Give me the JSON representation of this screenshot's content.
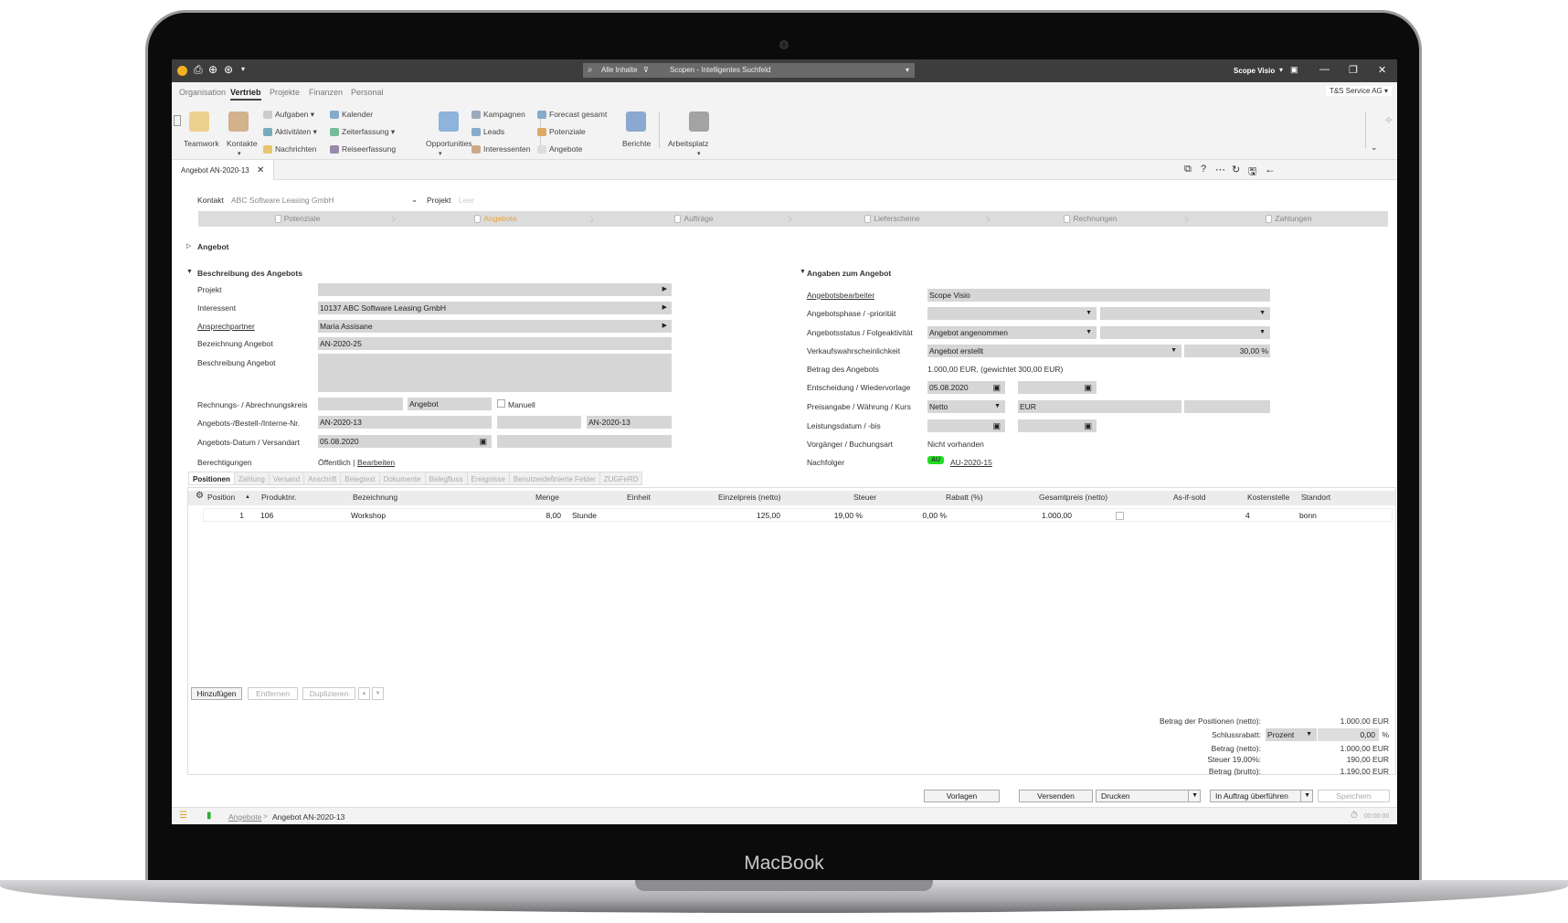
{
  "device": {
    "brand": "MacBook"
  },
  "titlebar": {
    "search_scope": "Alle Inhalte",
    "search_placeholder": "Scopen - Intelligentes Suchfeld",
    "user": "Scope Visio"
  },
  "company": "T&S Service AG",
  "menu_tabs": [
    "Organisation",
    "Vertrieb",
    "Projekte",
    "Finanzen",
    "Personal"
  ],
  "active_menu_tab": "Vertrieb",
  "ribbon": {
    "big": [
      {
        "label": "Teamwork",
        "icon": "teamwork-icon"
      },
      {
        "label": "Kontakte",
        "icon": "contacts-icon"
      },
      {
        "label": "Opportunities",
        "icon": "opportunities-icon"
      },
      {
        "label": "Berichte",
        "icon": "reports-icon"
      },
      {
        "label": "Arbeitsplatz",
        "icon": "workspace-icon"
      }
    ],
    "small": [
      {
        "label": "Aufgaben ▾",
        "icon": "tasks-icon"
      },
      {
        "label": "Aktivitäten ▾",
        "icon": "activities-icon"
      },
      {
        "label": "Nachrichten",
        "icon": "messages-icon"
      },
      {
        "label": "Kalender",
        "icon": "calendar-icon"
      },
      {
        "label": "Zeiterfassung ▾",
        "icon": "time-icon"
      },
      {
        "label": "Reiseerfassung",
        "icon": "travel-icon"
      },
      {
        "label": "Kampagnen",
        "icon": "campaigns-icon"
      },
      {
        "label": "Leads",
        "icon": "leads-icon"
      },
      {
        "label": "Interessenten",
        "icon": "prospects-icon"
      },
      {
        "label": "Forecast gesamt",
        "icon": "forecast-icon"
      },
      {
        "label": "Potenziale",
        "icon": "potentials-icon"
      },
      {
        "label": "Angebote",
        "icon": "offers-icon"
      }
    ]
  },
  "doc_tab": "Angebot AN-2020-13",
  "kontakt": {
    "label": "Kontakt",
    "value": "ABC Software Leasing GmbH",
    "projekt_label": "Projekt",
    "projekt_value": "Leer"
  },
  "process": [
    "Potenziale",
    "Angebote",
    "Aufträge",
    "Lieferscheine",
    "Rechnungen",
    "Zahlungen"
  ],
  "active_process": "Angebote",
  "sections": {
    "angebot": "Angebot",
    "beschreibung": "Beschreibung des Angebots",
    "angaben": "Angaben zum Angebot"
  },
  "left_form": {
    "projekt": "Projekt",
    "interessent": "Interessent",
    "interessent_val": "10137 ABC Software Leasing GmbH",
    "ansprech": "Ansprechpartner",
    "ansprech_val": "Maria Assisane",
    "bez": "Bezeichnung Angebot",
    "bez_val": "AN-2020-25",
    "beschr": "Beschreibung Angebot",
    "kreis": "Rechnungs- / Abrechnungskreis",
    "kreis_val2": "Angebot",
    "manuell": "Manuell",
    "nr": "Angebots-/Bestell-/Interne-Nr.",
    "nr_val": "AN-2020-13",
    "nr_val3": "AN-2020-13",
    "datum": "Angebots-Datum / Versandart",
    "datum_val": "05.08.2020",
    "berecht": "Berechtigungen",
    "berecht_val": "Öffentlich |",
    "berecht_link": "Bearbeiten"
  },
  "right_form": {
    "bearbeiter": "Angebotsbearbeiter",
    "bearbeiter_val": "Scope Visio",
    "phase": "Angebotsphase / -priorität",
    "status": "Angebotsstatus / Folgeaktivität",
    "status_val": "Angebot angenommen",
    "wahrsch": "Verkaufswahrscheinlichkeit",
    "wahrsch_val": "Angebot erstellt",
    "wahrsch_pct": "30,00 %",
    "betrag": "Betrag des Angebots",
    "betrag_val": "1.000,00 EUR, (gewichtet 300,00 EUR)",
    "entsch": "Entscheidung / Wiedervorlage",
    "entsch_val": "05.08.2020",
    "preis": "Preisangabe / Währung / Kurs",
    "preis_val": "Netto",
    "waehrung": "EUR",
    "leist": "Leistungsdatum / -bis",
    "vorg": "Vorgänger / Buchungsart",
    "vorg_val": "Nicht vorhanden",
    "nachf": "Nachfolger",
    "nachf_badge": "AU",
    "nachf_link": "AU-2020-15",
    "badge_color": "#22dd22"
  },
  "tabs": [
    "Positionen",
    "Zahlung",
    "Versand",
    "Anschrift",
    "Belegtext",
    "Dokumente",
    "Belegfluss",
    "Ereignisse",
    "Benutzerdefinierte Felder",
    "ZUGFeRD"
  ],
  "table": {
    "columns": [
      "Position",
      "Produktnr.",
      "Bezeichnung",
      "Menge",
      "Einheit",
      "Einzelpreis (netto)",
      "Steuer",
      "Rabatt (%)",
      "Gesamtpreis (netto)",
      "As-if-sold",
      "Kostenstelle",
      "Standort"
    ],
    "rows": [
      {
        "position": "1",
        "produktnr": "106",
        "bezeichnung": "Workshop",
        "menge": "8,00",
        "einheit": "Stunde",
        "einzelpreis": "125,00",
        "steuer": "19,00 %",
        "rabatt": "0,00 %",
        "gesamt": "1.000,00",
        "asifsold": false,
        "kostenstelle": "4",
        "standort": "bonn"
      }
    ]
  },
  "table_buttons": {
    "add": "Hinzufügen",
    "remove": "Entfernen",
    "duplicate": "Duplizieren",
    "up": "▲",
    "down": "▼"
  },
  "summary": {
    "pos_label": "Betrag der Positionen (netto):",
    "pos_val": "1.000,00 EUR",
    "rabatt_label": "Schlussrabatt:",
    "rabatt_type": "Prozent",
    "rabatt_val": "0,00",
    "rabatt_unit": "%",
    "netto_label": "Betrag (netto):",
    "netto_val": "1.000,00 EUR",
    "steuer_label": "Steuer 19,00%:",
    "steuer_val": "190,00 EUR",
    "brutto_label": "Betrag (brutto):",
    "brutto_val": "1.190,00 EUR"
  },
  "actions": {
    "vorlagen": "Vorlagen",
    "versenden": "Versenden",
    "drucken": "Drucken",
    "auftrag": "In Auftrag überführen",
    "speichern": "Speichern"
  },
  "statusbar": {
    "crumb_link": "Angebote",
    "sep": ">",
    "crumb_current": "Angebot AN-2020-13",
    "timer": "00:00:00"
  }
}
